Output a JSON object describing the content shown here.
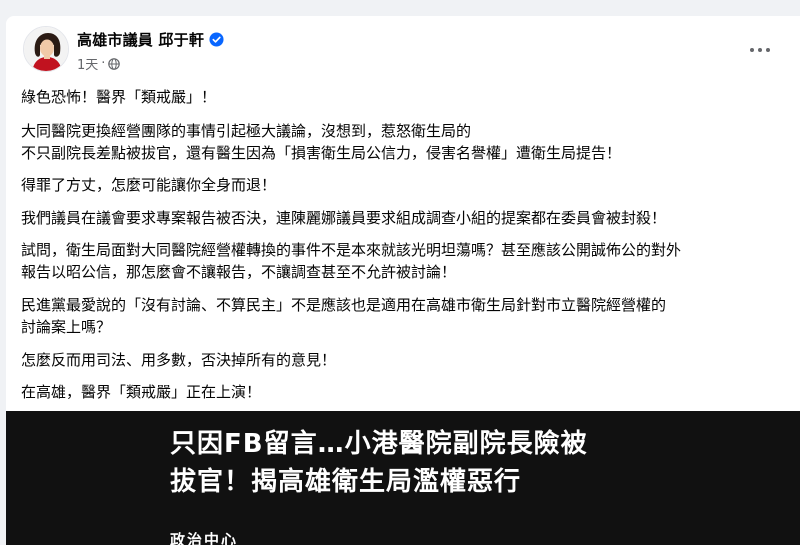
{
  "post": {
    "author": "高雄市議員 邱于軒",
    "timestamp": "1天",
    "privacy_icon": "globe-icon",
    "verified_icon": "verified-badge-icon",
    "paragraphs": [
      "綠色恐怖！醫界「類戒嚴」！",
      "大同醫院更換經營團隊的事情引起極大議論，沒想到，惹怒衛生局的\n不只副院長差點被拔官，還有醫生因為「損害衛生局公信力，侵害名譽權」遭衛生局提告！",
      "得罪了方丈，怎麼可能讓你全身而退！",
      "我們議員在議會要求專案報告被否決，連陳麗娜議員要求組成調查小組的提案都在委員會被封殺！",
      "試問，衛生局面對大同醫院經營權轉換的事件不是本來就該光明坦蕩嗎？甚至應該公開誠佈公的對外\n報告以昭公信，那怎麼會不讓報告，不讓調查甚至不允許被討論！",
      "民進黨最愛說的「沒有討論、不算民主」不是應該也是適用在高雄市衛生局針對市立醫院經營權的\n討論案上嗎？",
      "怎麼反而用司法、用多數，否決掉所有的意見！",
      "在高雄，醫界「類戒嚴」正在上演！"
    ]
  },
  "link_preview": {
    "headline": "只因FB留言…小港醫院副院長險被\n拔官！揭高雄衛生局濫權惡行",
    "source": "政治中心"
  },
  "colors": {
    "verified_blue": "#0866ff",
    "meta_gray": "#65676b",
    "preview_bg": "#111111"
  }
}
